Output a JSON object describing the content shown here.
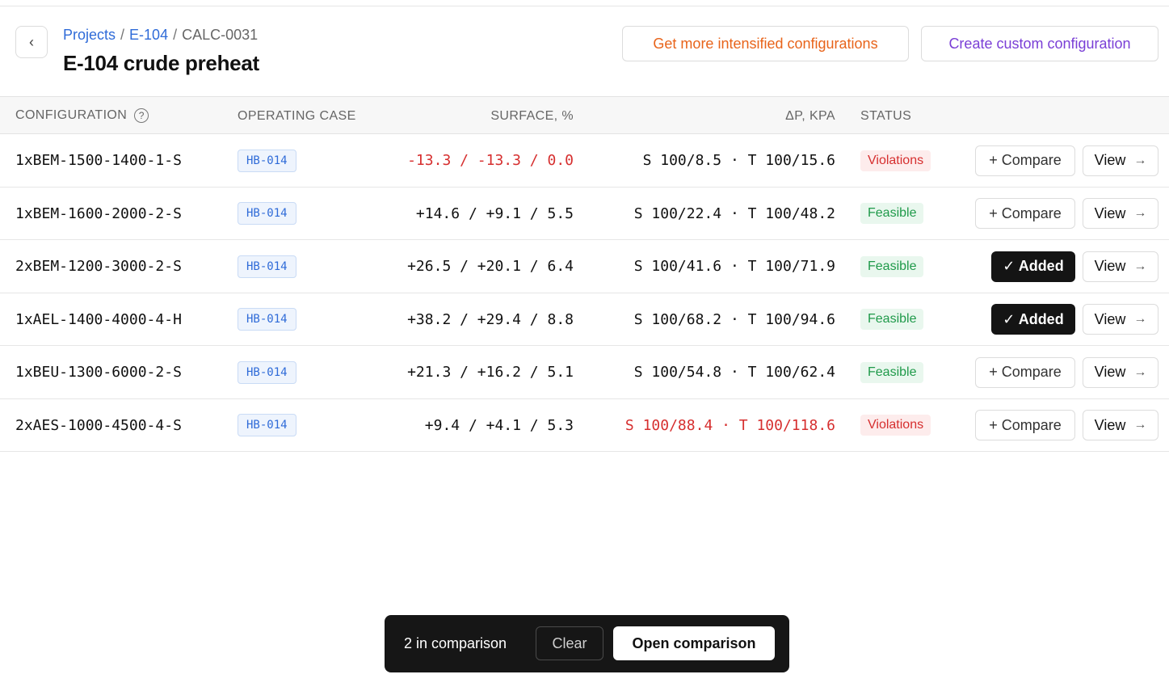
{
  "breadcrumb": {
    "projects": "Projects",
    "exchanger": "E-104",
    "separator": "/",
    "calc": "CALC-0031"
  },
  "page_title": "E-104 crude preheat",
  "header_actions": {
    "intensified_label": "Get more intensified configurations",
    "custom_label": "Create custom configuration"
  },
  "table": {
    "headers": {
      "configuration": "CONFIGURATION",
      "operating_case": "OPERATING CASE",
      "surface": "SURFACE, %",
      "dp": "ΔP, KPA",
      "status": "STATUS"
    },
    "rows": [
      {
        "config": "1xBEM-1500-1400-1-S",
        "case": "HB-014",
        "surface": "-13.3 / -13.3 / 0.0",
        "surface_alert": true,
        "dp": "S 100/8.5 · T 100/15.6",
        "dp_alert": false,
        "status": "Violations",
        "status_type": "violations",
        "in_comparison": false,
        "compare_label": "+ Compare",
        "view_label": "View"
      },
      {
        "config": "1xBEM-1600-2000-2-S",
        "case": "HB-014",
        "surface": "+14.6 / +9.1 / 5.5",
        "surface_alert": false,
        "dp": "S 100/22.4 · T 100/48.2",
        "dp_alert": false,
        "status": "Feasible",
        "status_type": "feasible",
        "in_comparison": false,
        "compare_label": "+ Compare",
        "view_label": "View"
      },
      {
        "config": "2xBEM-1200-3000-2-S",
        "case": "HB-014",
        "surface": "+26.5 / +20.1 / 6.4",
        "surface_alert": false,
        "dp": "S 100/41.6 · T 100/71.9",
        "dp_alert": false,
        "status": "Feasible",
        "status_type": "feasible",
        "in_comparison": true,
        "compare_label": "✓ Added",
        "view_label": "View"
      },
      {
        "config": "1xAEL-1400-4000-4-H",
        "case": "HB-014",
        "surface": "+38.2 / +29.4 / 8.8",
        "surface_alert": false,
        "dp": "S 100/68.2 · T 100/94.6",
        "dp_alert": false,
        "status": "Feasible",
        "status_type": "feasible",
        "in_comparison": true,
        "compare_label": "✓ Added",
        "view_label": "View"
      },
      {
        "config": "1xBEU-1300-6000-2-S",
        "case": "HB-014",
        "surface": "+21.3 / +16.2 / 5.1",
        "surface_alert": false,
        "dp": "S 100/54.8 · T 100/62.4",
        "dp_alert": false,
        "status": "Feasible",
        "status_type": "feasible",
        "in_comparison": false,
        "compare_label": "+ Compare",
        "view_label": "View"
      },
      {
        "config": "2xAES-1000-4500-4-S",
        "case": "HB-014",
        "surface": "+9.4 / +4.1 / 5.3",
        "surface_alert": false,
        "dp": "S 100/88.4 · T 100/118.6",
        "dp_alert": true,
        "status": "Violations",
        "status_type": "violations",
        "in_comparison": false,
        "compare_label": "+ Compare",
        "view_label": "View"
      }
    ]
  },
  "comparison_bar": {
    "count_label": "2 in comparison",
    "clear_label": "Clear",
    "open_label": "Open comparison"
  },
  "icons": {
    "back": "chevron-left-icon",
    "help": "question-circle-icon",
    "view_arrow": "arrow-right-icon"
  },
  "colors": {
    "link": "#2f6bd8",
    "intensified": "#e8641b",
    "custom": "#7a3fd6",
    "violation": "#d62f2f",
    "feasible": "#1f9a4a",
    "dark": "#141414"
  }
}
